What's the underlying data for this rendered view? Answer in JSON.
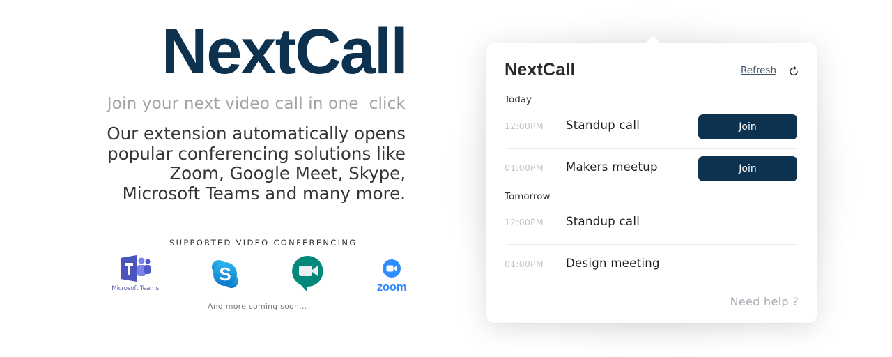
{
  "hero": {
    "title": "NextCall",
    "tagline": "Join your next video call in one  click",
    "description_lines": [
      "Our extension automatically opens",
      "popular conferencing solutions like",
      "Zoom, Google Meet, Skype,",
      "Microsoft Teams and many more."
    ],
    "supported_title": "SUPPORTED VIDEO CONFERENCING",
    "logos": [
      {
        "icon": "microsoft-teams-icon",
        "label": "Microsoft Teams",
        "color": "#5059c9"
      },
      {
        "icon": "skype-icon",
        "label": "",
        "color": "#1c9fe0"
      },
      {
        "icon": "google-meet-icon",
        "label": "",
        "color": "#00897b"
      },
      {
        "icon": "zoom-icon",
        "label": "zoom",
        "color": "#2d8cff"
      }
    ],
    "more_text": "And more coming soon..."
  },
  "popup": {
    "title": "NextCall",
    "refresh_label": "Refresh",
    "refresh_icon": "refresh-icon",
    "sections": [
      {
        "label": "Today",
        "events": [
          {
            "time": "12:00PM",
            "name": "Standup call",
            "action": "Join"
          },
          {
            "time": "01:00PM",
            "name": "Makers meetup",
            "action": "Join"
          }
        ]
      },
      {
        "label": "Tomorrow",
        "events": [
          {
            "time": "12:00PM",
            "name": "Standup call",
            "action": ""
          },
          {
            "time": "01:00PM",
            "name": "Design meeting",
            "action": ""
          }
        ]
      }
    ],
    "help_label": "Need help ?"
  },
  "colors": {
    "brand": "#0d3250",
    "muted": "#a1a1a8"
  }
}
